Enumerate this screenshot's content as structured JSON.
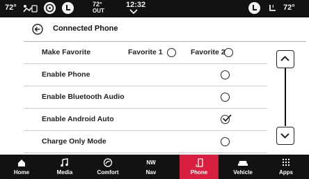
{
  "status": {
    "left_temp": "72°",
    "outside_temp": "72°",
    "outside_label": "OUT",
    "time": "12:32",
    "right_temp": "72°"
  },
  "header": {
    "title": "Connected Phone"
  },
  "settings": {
    "make_favorite": {
      "label": "Make Favorite",
      "option1": "Favorite 1",
      "option2": "Favorite 2",
      "option1_selected": false,
      "option2_selected": false
    },
    "enable_phone": {
      "label": "Enable Phone",
      "checked": false
    },
    "enable_bluetooth_audio": {
      "label": "Enable Bluetooth Audio",
      "checked": false
    },
    "enable_android_auto": {
      "label": "Enable Android Auto",
      "checked": true
    },
    "charge_only_mode": {
      "label": "Charge Only Mode",
      "checked": false
    }
  },
  "nav": {
    "home": "Home",
    "media": "Media",
    "comfort": "Comfort",
    "nav": "Nav",
    "nav_compass": "NW",
    "phone": "Phone",
    "vehicle": "Vehicle",
    "apps": "Apps",
    "active": "phone",
    "active_color": "#d81f3f"
  }
}
